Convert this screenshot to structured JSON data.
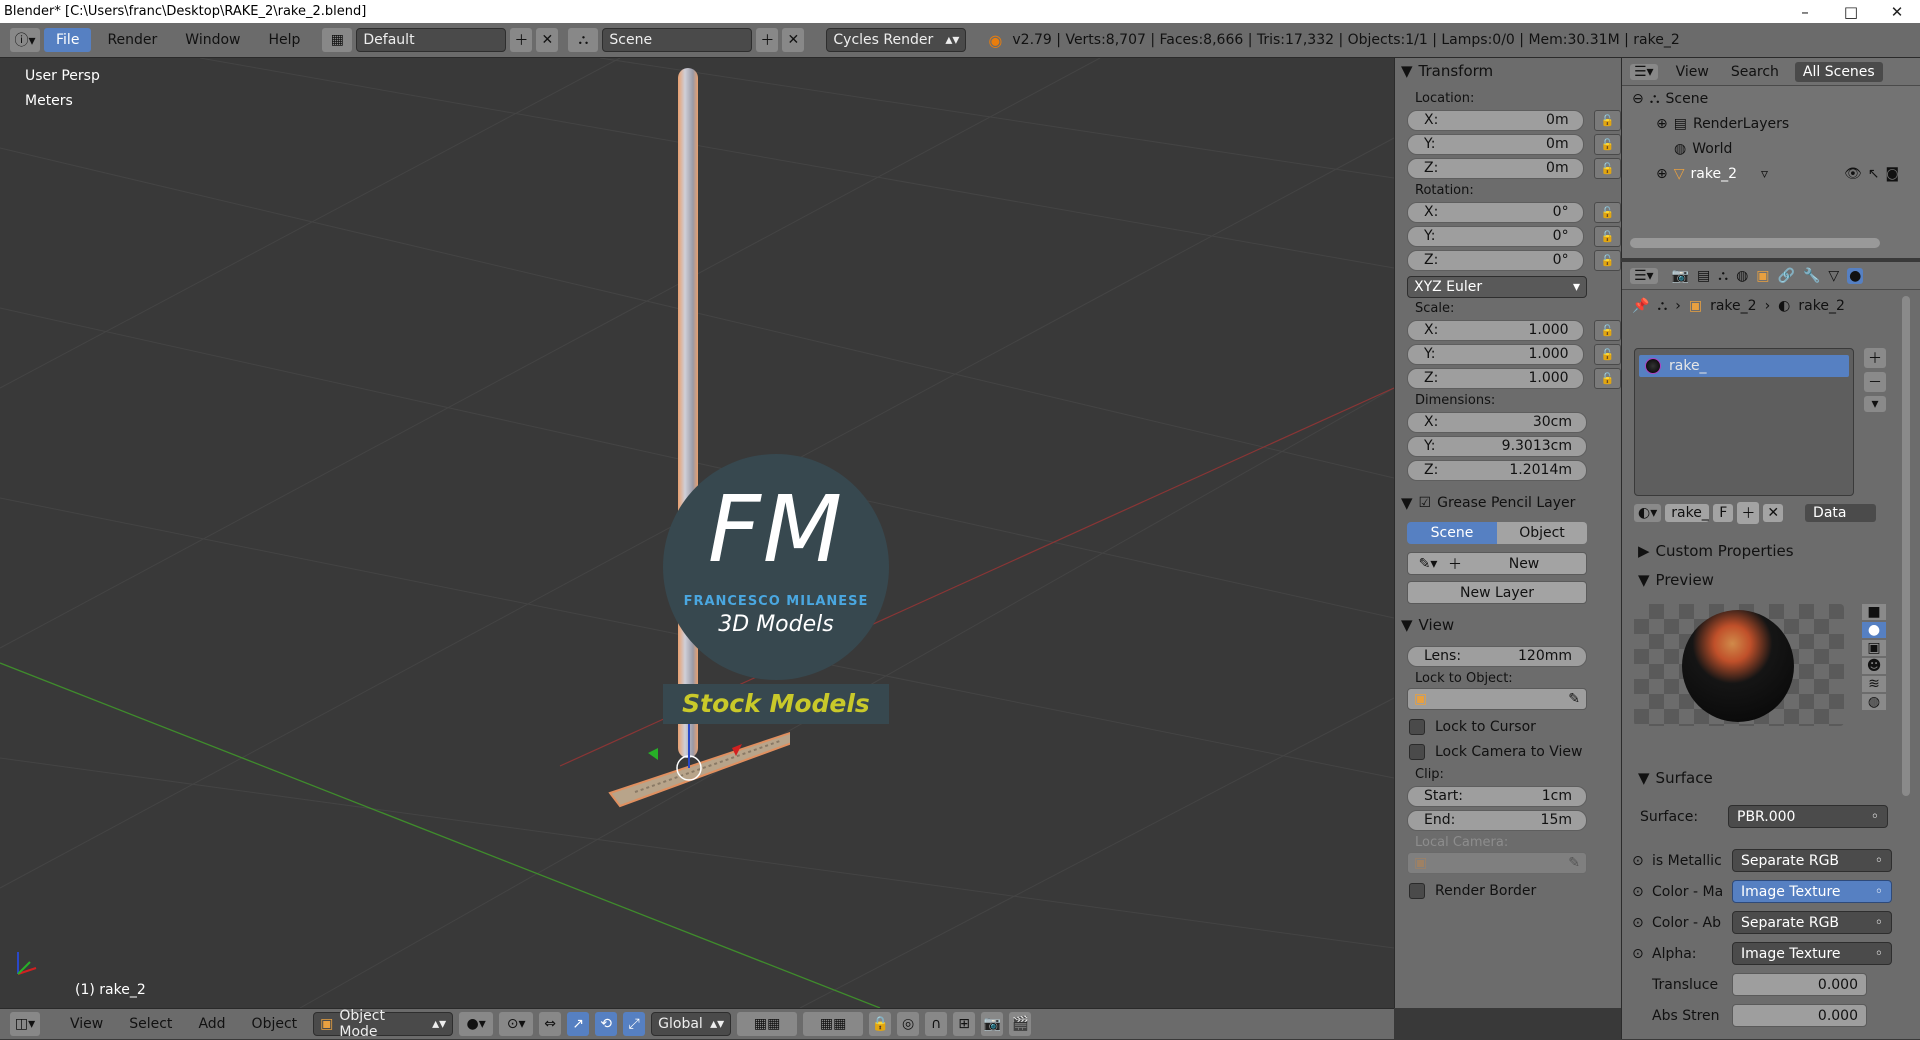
{
  "window": {
    "title": "Blender* [C:\\Users\\franc\\Desktop\\RAKE_2\\rake_2.blend]",
    "minimize": "–",
    "maximize": "□",
    "close": "✕"
  },
  "menu": {
    "items": [
      "File",
      "Render",
      "Window",
      "Help"
    ],
    "layout": "Default",
    "scene": "Scene",
    "engine": "Cycles Render",
    "stats": "v2.79 | Verts:8,707 | Faces:8,666 | Tris:17,332 | Objects:1/1 | Lamps:0/0 | Mem:30.31M | rake_2"
  },
  "viewport": {
    "view_name": "User Persp",
    "units": "Meters",
    "object_info": "(1) rake_2",
    "logo": {
      "letters": "FM",
      "name": "FRANCESCO MILANESE",
      "tagline": "3D Models",
      "banner": "Stock Models"
    }
  },
  "transform": {
    "title": "Transform",
    "location_label": "Location:",
    "location": [
      {
        "axis": "X:",
        "value": "0m"
      },
      {
        "axis": "Y:",
        "value": "0m"
      },
      {
        "axis": "Z:",
        "value": "0m"
      }
    ],
    "rotation_label": "Rotation:",
    "rotation": [
      {
        "axis": "X:",
        "value": "0°"
      },
      {
        "axis": "Y:",
        "value": "0°"
      },
      {
        "axis": "Z:",
        "value": "0°"
      }
    ],
    "rotation_mode": "XYZ Euler",
    "scale_label": "Scale:",
    "scale": [
      {
        "axis": "X:",
        "value": "1.000"
      },
      {
        "axis": "Y:",
        "value": "1.000"
      },
      {
        "axis": "Z:",
        "value": "1.000"
      }
    ],
    "dimensions_label": "Dimensions:",
    "dimensions": [
      {
        "axis": "X:",
        "value": "30cm"
      },
      {
        "axis": "Y:",
        "value": "9.3013cm"
      },
      {
        "axis": "Z:",
        "value": "1.2014m"
      }
    ]
  },
  "grease_pencil": {
    "title": "Grease Pencil Layer",
    "tab_scene": "Scene",
    "tab_object": "Object",
    "new_label": "New",
    "new_layer_label": "New Layer"
  },
  "view_panel": {
    "title": "View",
    "lens_label": "Lens:",
    "lens_value": "120mm",
    "lock_object_label": "Lock to Object:",
    "lock_cursor": "Lock to Cursor",
    "lock_camera": "Lock Camera to View",
    "clip_label": "Clip:",
    "clip_start_label": "Start:",
    "clip_start": "1cm",
    "clip_end_label": "End:",
    "clip_end": "15m",
    "local_camera": "Local Camera:",
    "render_border": "Render Border"
  },
  "outliner": {
    "view": "View",
    "search": "Search",
    "filter": "All Scenes",
    "items": [
      "Scene",
      "RenderLayers",
      "World",
      "rake_2"
    ]
  },
  "properties": {
    "breadcrumb_object": "rake_2",
    "breadcrumb_material": "rake_2",
    "material_slot": "rake_",
    "material_name": "rake_",
    "fake_user": "F",
    "link_type": "Data",
    "custom_properties": "Custom Properties",
    "preview": "Preview",
    "surface_title": "Surface",
    "surface_label": "Surface:",
    "surface_value": "PBR.000",
    "inputs": [
      {
        "label": "is Metallic",
        "value": "Separate RGB"
      },
      {
        "label": "Color - Ma",
        "value": "Image Texture"
      },
      {
        "label": "Color - Ab",
        "value": "Separate RGB"
      },
      {
        "label": "Alpha:",
        "value": "Image Texture"
      }
    ],
    "translucency_label": "Transluce",
    "translucency": "0.000",
    "abs_label": "Abs Stren",
    "abs": "0.000"
  },
  "bottom": {
    "view": "View",
    "select": "Select",
    "add": "Add",
    "object": "Object",
    "mode": "Object Mode",
    "orientation": "Global"
  },
  "colors": {
    "accent": "#5680c2",
    "viewport_bg": "#393939",
    "panel_bg": "#6c6c6c",
    "logo_blue": "#4aa7e0",
    "logo_yellow": "#c9c92a"
  }
}
